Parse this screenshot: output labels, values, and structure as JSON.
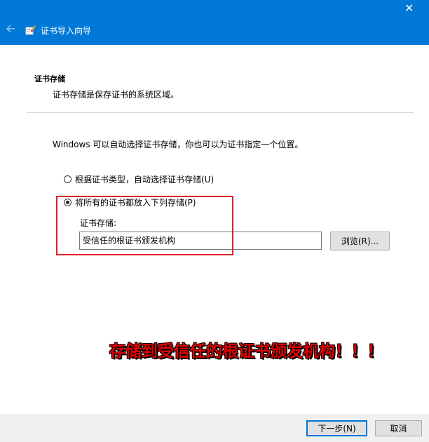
{
  "window": {
    "title": "证书导入向导",
    "close_symbol": "✕"
  },
  "header": {
    "title": "证书存储",
    "description": "证书存储是保存证书的系统区域。"
  },
  "body": {
    "intro": "Windows 可以自动选择证书存储，你也可以为证书指定一个位置。",
    "radio_auto": {
      "label": "根据证书类型，自动选择证书存储(U)",
      "checked": false
    },
    "radio_manual": {
      "label": "将所有的证书都放入下列存储(P)",
      "checked": true
    },
    "store_label": "证书存储:",
    "store_value": "受信任的根证书颁发机构",
    "browse_label": "浏览(R)..."
  },
  "annotation": {
    "text": "存储到受信任的根证书颁发机构！！！",
    "color": "#e00000"
  },
  "footer": {
    "next_label": "下一步(N)",
    "cancel_label": "取消"
  },
  "colors": {
    "titlebar": "#0078d7",
    "highlight_box": "#e0202a"
  },
  "icons": {
    "back": "back-arrow-icon",
    "wizard": "certificate-wizard-icon",
    "close": "close-icon"
  }
}
